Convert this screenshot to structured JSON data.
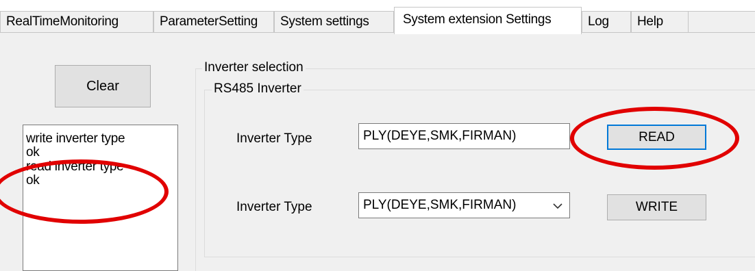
{
  "tabs": [
    {
      "label": "RealTimeMonitoring"
    },
    {
      "label": "ParameterSetting"
    },
    {
      "label": "System settings"
    },
    {
      "label": "System extension Settings"
    },
    {
      "label": "Log"
    },
    {
      "label": "Help"
    }
  ],
  "active_tab": "System extension Settings",
  "clear_button": "Clear",
  "log": {
    "lines": [
      "write inverter type",
      "ok",
      "read inverter type",
      "ok"
    ]
  },
  "inverter_selection": {
    "group_title": "Inverter selection",
    "rs485": {
      "group_title": "RS485 Inverter",
      "read_row": {
        "label": "Inverter Type",
        "value": "PLY(DEYE,SMK,FIRMAN)",
        "button": "READ"
      },
      "write_row": {
        "label": "Inverter Type",
        "selected": "PLY(DEYE,SMK,FIRMAN)",
        "button": "WRITE"
      }
    }
  },
  "colors": {
    "annotation": "#e10000",
    "focus_border": "#0078d7",
    "panel_background": "#f0f0f0"
  },
  "icons": {
    "dropdown": "chevron-down-icon"
  }
}
